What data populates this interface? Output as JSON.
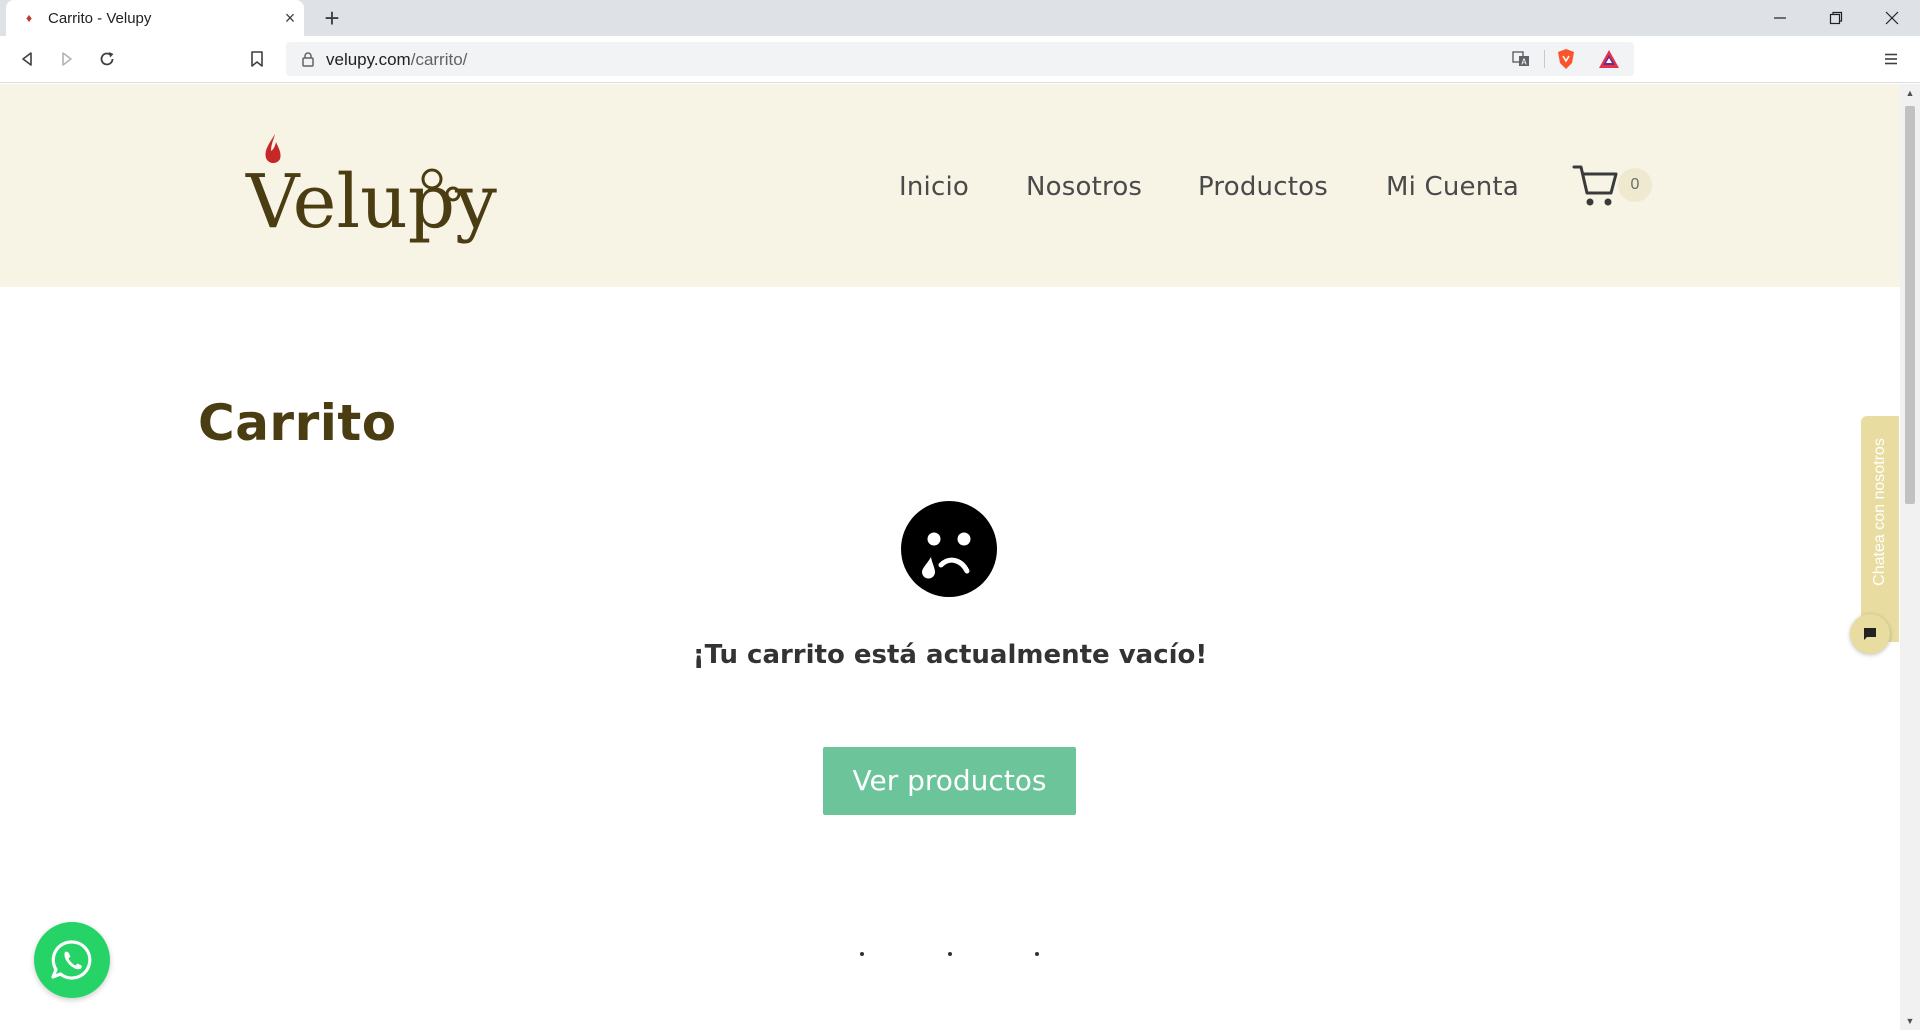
{
  "browser": {
    "tab_title": "Carrito - Velupy",
    "url_host": "velupy.com",
    "url_path": "/carrito/"
  },
  "site": {
    "logo_text": "Velupy",
    "nav": [
      "Inicio",
      "Nosotros",
      "Productos",
      "Mi Cuenta"
    ],
    "cart_count": "0"
  },
  "cart_page": {
    "title": "Carrito",
    "empty_message": "¡Tu carrito está actualmente vacío!",
    "button_label": "Ver productos"
  },
  "chat_widget": {
    "label": "Chatea con nosotros"
  },
  "colors": {
    "header_bg": "#f7f4e6",
    "title_brown": "#4b3d12",
    "button_green": "#6cc49a",
    "whatsapp_green": "#25d366",
    "chat_tab": "#e8dca0"
  }
}
